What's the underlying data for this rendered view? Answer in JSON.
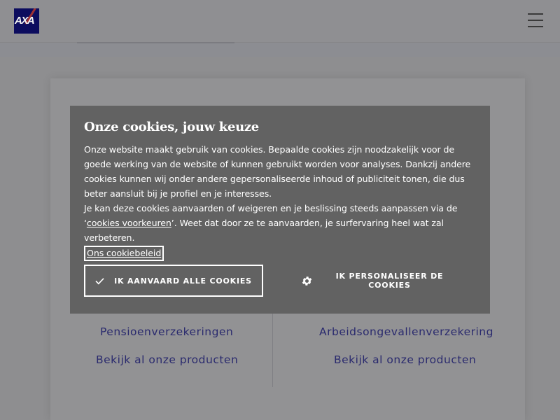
{
  "header": {
    "logo_text": "AXA",
    "menu_icon": "hamburger-menu-icon"
  },
  "cookie_modal": {
    "title": "Onze cookies, jouw keuze",
    "paragraph_1": "Onze website maakt gebruik van cookies. Bepaalde cookies zijn noodzakelijk voor de goede werking van de website of kunnen gebruikt worden voor analyses. Dankzij andere cookies kunnen wij onder andere gepersonaliseerde inhoud of publiciteit tonen, die dus beter aansluit bij je profiel en je interesses.",
    "paragraph_2_before": "Je kan deze cookies aanvaarden of weigeren en je beslissing steeds aanpassen via de ‘",
    "paragraph_2_link": "cookies voorkeuren",
    "paragraph_2_after": "’. Weet dat door ze te aanvaarden, je surfervaring heel wat zal verbeteren.",
    "policy_link": "Ons cookiebeleid",
    "accept_button": "IK AANVAARD ALLE COOKIES",
    "accept_icon": "checkmark-icon",
    "personalise_button": "IK PERSONALISEER DE COOKIES",
    "personalise_icon": "gear-icon"
  },
  "products": {
    "left_item": "Pensioenverzekeringen",
    "left_all": "Bekijk al onze producten",
    "right_item": "Arbeidsongevallenverzekering",
    "right_all": "Bekijk al onze producten"
  },
  "colors": {
    "brand": "#00008f",
    "brand_red": "#ff1721",
    "modal_bg": "#626262",
    "link": "#2a2a6e"
  }
}
